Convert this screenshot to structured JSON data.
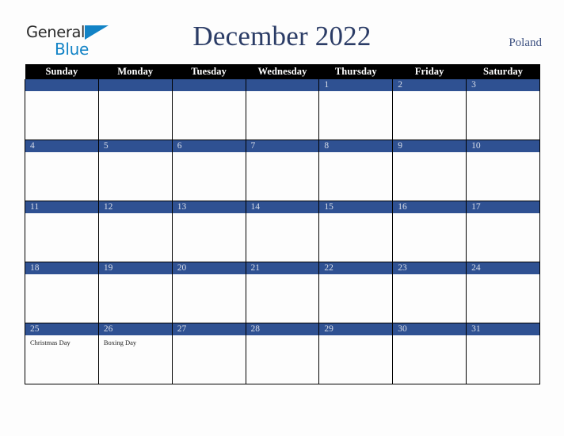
{
  "brand": {
    "name_part1": "General",
    "name_part2": "Blue",
    "triangle_icon": "triangle-icon",
    "color_dark": "#2b2b2b",
    "color_blue": "#1283c6"
  },
  "header": {
    "title": "December 2022",
    "country": "Poland",
    "title_color": "#2b3c66",
    "country_color": "#3c5080"
  },
  "theme": {
    "accent_blue": "#2f5192",
    "header_bar": "#000000",
    "page_background": "#fdfdfd",
    "date_text": "#d8dde8",
    "event_text": "#222222"
  },
  "calendar": {
    "month": "December",
    "year": "2022",
    "weekday_headers": [
      "Sunday",
      "Monday",
      "Tuesday",
      "Wednesday",
      "Thursday",
      "Friday",
      "Saturday"
    ],
    "weeks": [
      [
        {
          "date": "",
          "events": []
        },
        {
          "date": "",
          "events": []
        },
        {
          "date": "",
          "events": []
        },
        {
          "date": "",
          "events": []
        },
        {
          "date": "1",
          "events": []
        },
        {
          "date": "2",
          "events": []
        },
        {
          "date": "3",
          "events": []
        }
      ],
      [
        {
          "date": "4",
          "events": []
        },
        {
          "date": "5",
          "events": []
        },
        {
          "date": "6",
          "events": []
        },
        {
          "date": "7",
          "events": []
        },
        {
          "date": "8",
          "events": []
        },
        {
          "date": "9",
          "events": []
        },
        {
          "date": "10",
          "events": []
        }
      ],
      [
        {
          "date": "11",
          "events": []
        },
        {
          "date": "12",
          "events": []
        },
        {
          "date": "13",
          "events": []
        },
        {
          "date": "14",
          "events": []
        },
        {
          "date": "15",
          "events": []
        },
        {
          "date": "16",
          "events": []
        },
        {
          "date": "17",
          "events": []
        }
      ],
      [
        {
          "date": "18",
          "events": []
        },
        {
          "date": "19",
          "events": []
        },
        {
          "date": "20",
          "events": []
        },
        {
          "date": "21",
          "events": []
        },
        {
          "date": "22",
          "events": []
        },
        {
          "date": "23",
          "events": []
        },
        {
          "date": "24",
          "events": []
        }
      ],
      [
        {
          "date": "25",
          "events": [
            "Christmas Day"
          ]
        },
        {
          "date": "26",
          "events": [
            "Boxing Day"
          ]
        },
        {
          "date": "27",
          "events": []
        },
        {
          "date": "28",
          "events": []
        },
        {
          "date": "29",
          "events": []
        },
        {
          "date": "30",
          "events": []
        },
        {
          "date": "31",
          "events": []
        }
      ]
    ]
  }
}
